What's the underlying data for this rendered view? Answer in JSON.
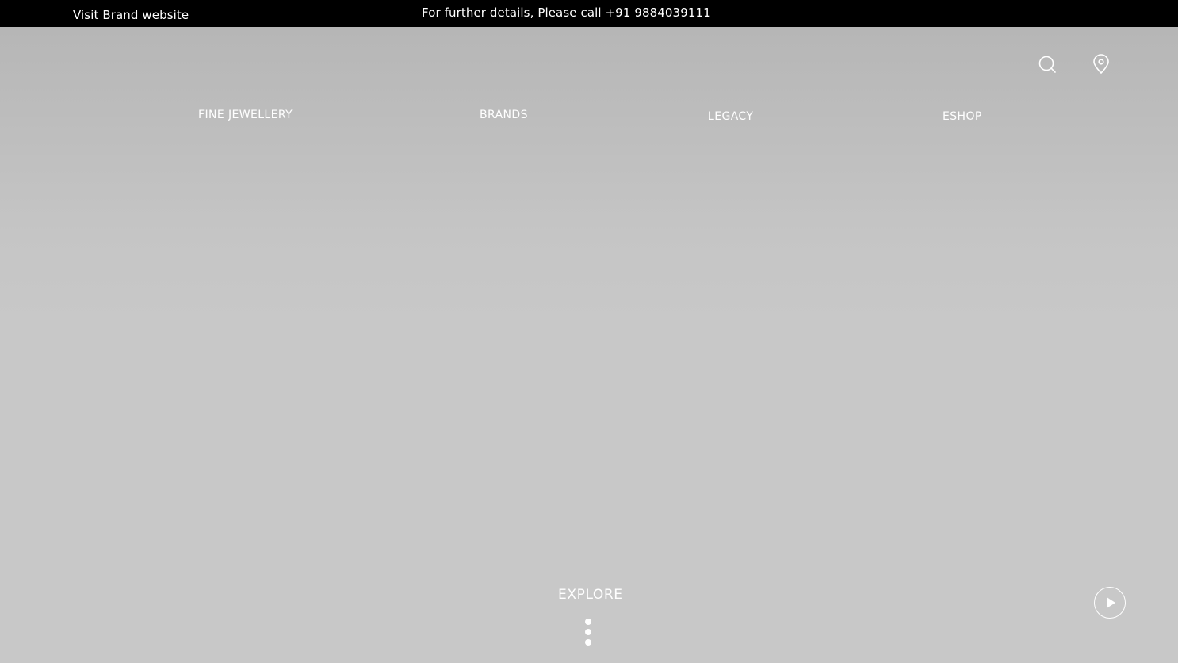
{
  "topbar": {
    "brand_link": "Visit Brand website",
    "contact_text": "For further details, Please call +91 9884039111"
  },
  "header": {
    "icons": [
      "search-icon",
      "location-pin-icon"
    ]
  },
  "nav": {
    "items": [
      {
        "label": "FINE JEWELLERY"
      },
      {
        "label": "BRANDS"
      },
      {
        "label": "LEGACY"
      },
      {
        "label": "ESHOP"
      }
    ]
  },
  "hero": {
    "explore_label": "EXPLORE",
    "play_icon": "play-icon",
    "scroll_icon": "vertical-dots-icon"
  },
  "colors": {
    "topbar_bg": "#000000",
    "hero_bg": "#c8c8c8",
    "text": "#ffffff"
  }
}
